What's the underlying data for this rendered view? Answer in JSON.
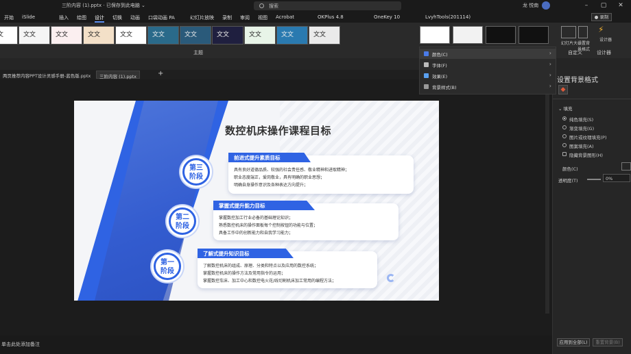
{
  "titlebar": {
    "filename": "三阶内容 (1).pptx · 已保存到此电脑 ⌄",
    "search_placeholder": "搜索",
    "user": "龙 悦南"
  },
  "menu": [
    "开始",
    "iSlide",
    "插入",
    "绘图",
    "设计",
    "切换",
    "动画",
    "口袋动画 PA",
    "幻灯片放映",
    "录制",
    "审阅",
    "视图",
    "Acrobat",
    "OKPlus 4.8",
    "OneKey 10",
    "LvyhTools(201114)"
  ],
  "menu_active": "设计",
  "record_btn": "● 录制",
  "themes_label": "文文",
  "ribbon_groups": {
    "themes": "主题",
    "customize": "自定义",
    "designer": "设计器",
    "slide_size": "幻灯片大小",
    "format_bg": "设置背景格式",
    "designer_btn": "设计器"
  },
  "doc_tabs": [
    "两页推荐内容PPT设计灵感手册-蓝色版.pptx",
    "三阶内容 (1).pptx"
  ],
  "dropdown": [
    {
      "label": "颜色(C)",
      "color": "#4a7be8"
    },
    {
      "label": "字体(F)",
      "color": "#ddd"
    },
    {
      "label": "效果(E)",
      "color": "#5aa0f0"
    },
    {
      "label": "背景样式(B)",
      "color": "#bbb"
    }
  ],
  "slide": {
    "title": "数控机床操作课程目标",
    "stages": [
      {
        "circle_top": "第三",
        "circle_bottom": "阶段",
        "heading": "前进式提升素质目标",
        "bullets": [
          "具有良好道德品质、较强的社会责任感、敬业精神和进取精神；",
          "职业态度端正，爱岗敬业，具有明确的职业思想；",
          "明确自身操作意识及各种表达方向提升；"
        ]
      },
      {
        "circle_top": "第二",
        "circle_bottom": "阶段",
        "heading": "掌握式提升能力目标",
        "bullets": [
          "掌握数控加工行业必备的基础理论知识；",
          "熟悉数控机床的操作面板每个控制按钮的功能与位置；",
          "具备工作中的创新能力和自我学习能力；"
        ]
      },
      {
        "circle_top": "第一",
        "circle_bottom": "阶段",
        "heading": "了解式提升知识目标",
        "bullets": [
          "了解数控机床的组成、原理、分类和特点以及应用的数控系统；",
          "掌握数控机床的操作方法及常用指令的运用；",
          "掌握数控车床、加工中心和数控电火花/线切割机床加工常用的编程方法；"
        ]
      }
    ]
  },
  "pane": {
    "title": "设置背景格式",
    "section": "填充",
    "options": [
      "纯色填充(S)",
      "渐变填充(G)",
      "图片或纹理填充(P)",
      "图案填充(A)"
    ],
    "hide_bg": "隐藏背景图形(H)",
    "color_label": "颜色(C)",
    "transparency_label": "透明度(T)",
    "transparency_value": "0%",
    "apply_all": "应用到全部(L)",
    "reset": "重置背景(B)"
  },
  "status": {
    "notes": "单击此处添加备注"
  }
}
